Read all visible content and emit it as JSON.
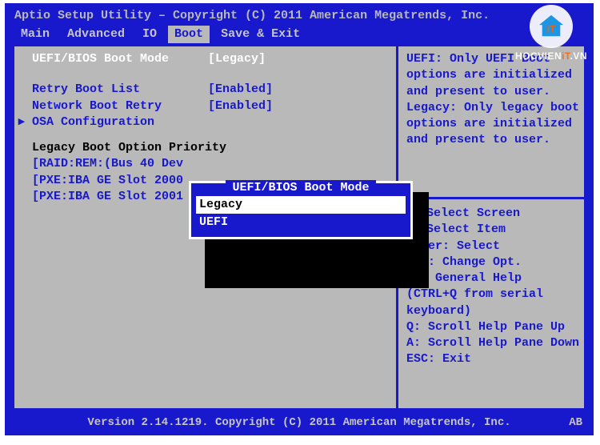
{
  "header": {
    "title": "Aptio Setup Utility – Copyright (C) 2011 American Megatrends, Inc."
  },
  "menu": {
    "items": [
      "Main",
      "Advanced",
      "IO",
      "Boot",
      "Save & Exit"
    ],
    "active_index": 3
  },
  "settings": {
    "uefi_bios_boot_mode": {
      "label": "UEFI/BIOS Boot Mode",
      "value": "[Legacy]"
    },
    "retry_boot_list": {
      "label": "Retry Boot List",
      "value": "[Enabled]"
    },
    "network_boot_retry": {
      "label": "Network Boot Retry",
      "value": "[Enabled]"
    },
    "osa_configuration": {
      "label": "OSA Configuration"
    }
  },
  "legacy_priority": {
    "heading": "Legacy Boot Option Priority",
    "items": [
      "[RAID:REM:(Bus 40 Dev",
      "[PXE:IBA GE Slot 2000",
      "[PXE:IBA GE Slot 2001"
    ]
  },
  "popup": {
    "title": "UEFI/BIOS Boot Mode",
    "options": [
      "Legacy",
      "UEFI"
    ],
    "selected_index": 0
  },
  "help": {
    "text": "UEFI: Only UEFI Boot options are initialized and present to user. Legacy: Only legacy boot options are initialized and present to user."
  },
  "keys": {
    "lines": [
      {
        "glyph": "↔",
        "text": "Select Screen"
      },
      {
        "glyph": "↕",
        "text": "Select Item"
      },
      {
        "glyph": "",
        "text": "Enter: Select"
      },
      {
        "glyph": "",
        "text": "+/-: Change Opt."
      },
      {
        "glyph": "",
        "text": "F1: General Help"
      },
      {
        "glyph": "",
        "text": "(CTRL+Q from serial"
      },
      {
        "glyph": "",
        "text": "keyboard)"
      },
      {
        "glyph": "",
        "text": "Q: Scroll Help Pane Up"
      },
      {
        "glyph": "",
        "text": "A: Scroll Help Pane Down"
      },
      {
        "glyph": "",
        "text": "ESC: Exit"
      }
    ]
  },
  "footer": {
    "version": "Version 2.14.1219. Copyright (C) 2011 American Megatrends, Inc.",
    "badge": "AB"
  },
  "watermark": {
    "label": "HOCVIENiT.VN",
    "part_hv": "HOCVIEN",
    "part_it": "iT",
    "part_vn": ".VN"
  }
}
